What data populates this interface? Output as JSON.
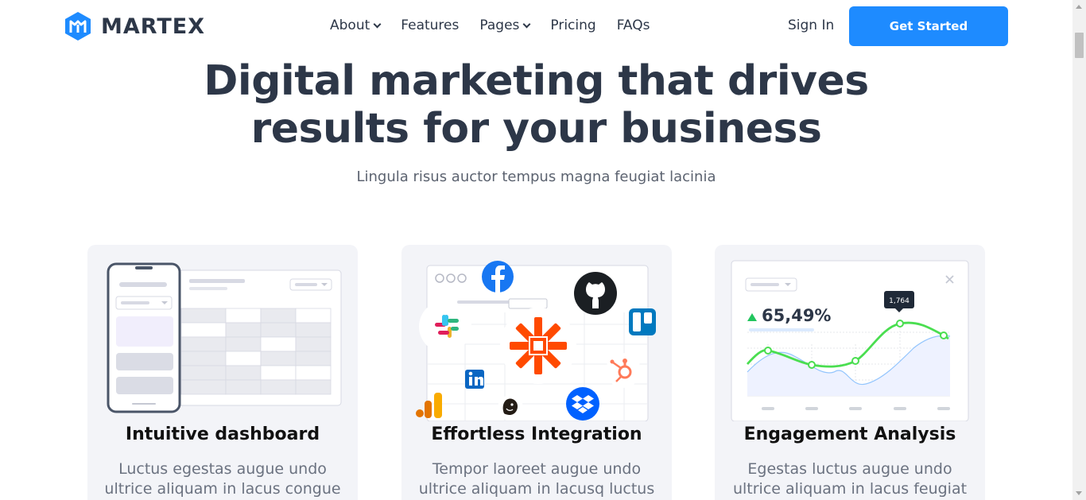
{
  "brand": {
    "name": "MARTEX",
    "logo_icon": "martex-logo-icon",
    "accent_color": "#1e8bff"
  },
  "nav": {
    "items": [
      {
        "label": "About",
        "has_dropdown": true
      },
      {
        "label": "Features",
        "has_dropdown": false
      },
      {
        "label": "Pages",
        "has_dropdown": true
      },
      {
        "label": "Pricing",
        "has_dropdown": false
      },
      {
        "label": "FAQs",
        "has_dropdown": false
      }
    ],
    "signin_label": "Sign In",
    "cta_label": "Get Started"
  },
  "hero": {
    "title_line1": "Digital marketing that drives",
    "title_line2": "results for your business",
    "subtitle": "Lingula risus auctor tempus magna feugiat lacinia"
  },
  "cards": [
    {
      "title": "Intuitive dashboard",
      "text_line1": "Luctus egestas augue undo",
      "text_line2": "ultrice aliquam in lacus congue",
      "illustration": "dashboard-mockup"
    },
    {
      "title": "Effortless Integration",
      "text_line1": "Tempor laoreet augue undo",
      "text_line2": "ultrice aliquam in lacusq luctus",
      "illustration": "integrations-icons"
    },
    {
      "title": "Engagement Analysis",
      "text_line1": "Egestas luctus augue undo",
      "text_line2": "ultrice aliquam in lacus feugiat",
      "illustration": "analytics-chart",
      "stat_value": "65,49%",
      "tooltip_value": "1,764"
    }
  ]
}
